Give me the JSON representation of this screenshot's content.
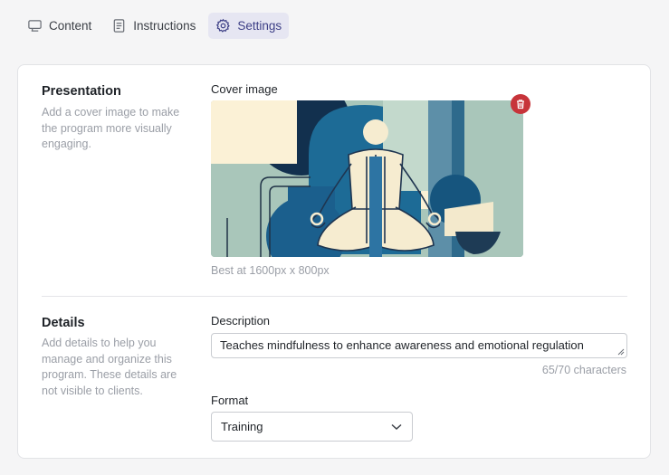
{
  "tabs": [
    {
      "label": "Content",
      "icon": "monitor-icon",
      "active": false
    },
    {
      "label": "Instructions",
      "icon": "document-icon",
      "active": false
    },
    {
      "label": "Settings",
      "icon": "gear-icon",
      "active": true
    }
  ],
  "presentation": {
    "title": "Presentation",
    "description": "Add a cover image to make the program more visually engaging.",
    "cover_label": "Cover image",
    "cover_hint": "Best at 1600px x 800px"
  },
  "details": {
    "title": "Details",
    "description": "Add details to help you manage and organize this program. These details are not visible to clients.",
    "description_label": "Description",
    "description_value": "Teaches mindfulness to enhance awareness and emotional regulation",
    "char_count": "65/70 characters",
    "format_label": "Format",
    "format_value": "Training"
  },
  "colors": {
    "accent": "#3d3f86",
    "active_tab_bg": "#e6e6f2",
    "delete": "#c7343a"
  }
}
